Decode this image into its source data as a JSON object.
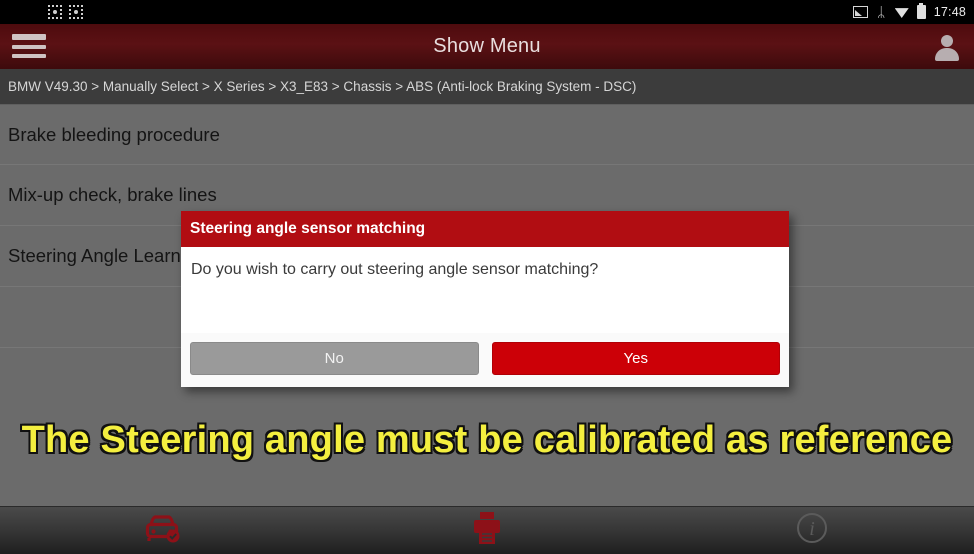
{
  "statusbar": {
    "time": "17:48",
    "left_icons": [
      {
        "name": "notification-flag-icon"
      },
      {
        "name": "notification-square-icon"
      },
      {
        "name": "screenshot-frame-icon"
      },
      {
        "name": "screenshot-frame-icon-2"
      }
    ],
    "right_icons": [
      {
        "name": "screencast-icon"
      },
      {
        "name": "bluetooth-icon",
        "glyph": "ᛦ"
      },
      {
        "name": "wifi-icon"
      },
      {
        "name": "battery-icon"
      }
    ]
  },
  "header": {
    "title": "Show Menu",
    "menu_badge": true,
    "accent": "#5b1114"
  },
  "breadcrumb": {
    "text": "BMW V49.30 > Manually Select > X Series > X3_E83 > Chassis > ABS (Anti-lock Braking System - DSC)"
  },
  "list": {
    "items": [
      {
        "label": "Brake bleeding procedure"
      },
      {
        "label": "Mix-up check, brake lines"
      },
      {
        "label": "Steering Angle Learning"
      },
      {
        "label": ""
      }
    ]
  },
  "dialog": {
    "title": "Steering angle sensor matching",
    "message": "Do you wish to carry out steering angle sensor matching?",
    "no_label": "No",
    "yes_label": "Yes",
    "title_color": "#b10d12",
    "yes_color": "#cc0007",
    "no_color": "#9a9a9a"
  },
  "caption": {
    "text": "The Steering angle must be calibrated as reference",
    "color": "#f4ef3f"
  },
  "toolbar": {
    "buttons": [
      {
        "name": "vehicle-status-icon"
      },
      {
        "name": "print-icon"
      },
      {
        "name": "info-icon"
      }
    ]
  }
}
